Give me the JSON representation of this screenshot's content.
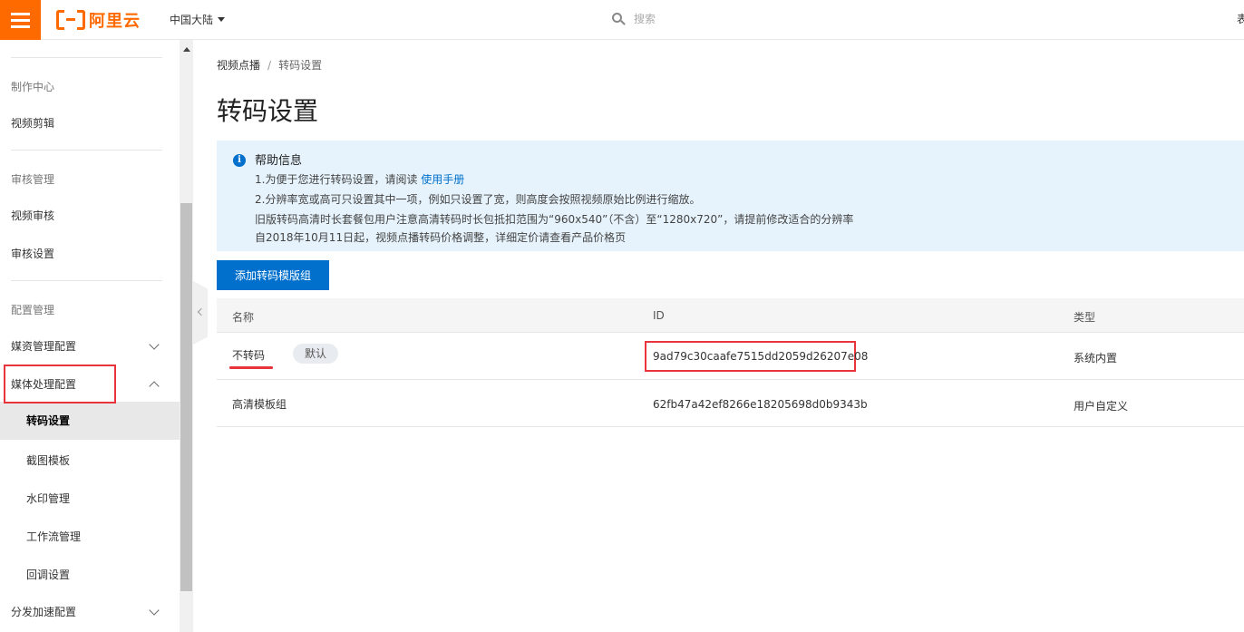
{
  "topbar": {
    "logo_text": "阿里云",
    "region": "中国大陆",
    "search_placeholder": "搜索",
    "right_cut_text": "表"
  },
  "sidebar": {
    "groups": [
      {
        "title": "制作中心",
        "items": [
          "视频剪辑"
        ]
      },
      {
        "title": "审核管理",
        "items": [
          "视频审核",
          "审核设置"
        ]
      },
      {
        "title": "配置管理",
        "items": [
          "媒资管理配置",
          "媒体处理配置"
        ]
      }
    ],
    "media_sub_items": [
      "转码设置",
      "截图模板",
      "水印管理",
      "工作流管理",
      "回调设置"
    ],
    "bottom_item": "分发加速配置",
    "active_item": "转码设置"
  },
  "breadcrumb": {
    "root": "视频点播",
    "separator": "/",
    "current": "转码设置"
  },
  "page_title": "转码设置",
  "help": {
    "title": "帮助信息",
    "line1_prefix": "1.为便于您进行转码设置，请阅读",
    "line1_link": "使用手册",
    "line2": "2.分辨率宽或高可只设置其中一项，例如只设置了宽，则高度会按照视频原始比例进行缩放。",
    "line3": "旧版转码高清时长套餐包用户注意高清转码时长包抵扣范围为“960x540”（不含）至“1280x720”，请提前修改适合的分辨率",
    "line4": "自2018年10月11日起，视频点播转码价格调整，详细定价请查看产品价格页"
  },
  "add_button": "添加转码模版组",
  "table": {
    "columns": [
      "名称",
      "ID",
      "类型"
    ],
    "rows": [
      {
        "name": "不转码",
        "badge": "默认",
        "id": "9ad79c30caafe7515dd2059d26207e08",
        "type": "系统内置"
      },
      {
        "name": "高清模板组",
        "badge": "",
        "id": "62fb47a42ef8266e18205698d0b9343b",
        "type": "用户自定义"
      }
    ]
  },
  "colors": {
    "brand": "#ff6a00",
    "primary": "#0070cc",
    "highlight": "#e8353b",
    "help_bg": "#e6f3fc"
  }
}
